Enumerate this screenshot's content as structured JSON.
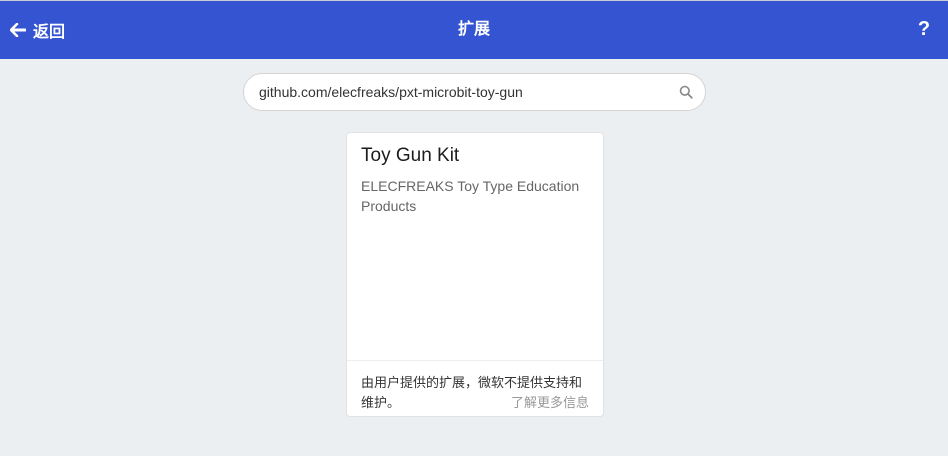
{
  "header": {
    "back_label": "返回",
    "title": "扩展",
    "help_label": "?",
    "color": "#3454d1"
  },
  "search": {
    "value": "github.com/elecfreaks/pxt-microbit-toy-gun",
    "icon": "search-icon"
  },
  "card": {
    "title": "Toy Gun Kit",
    "description": "ELECFREAKS Toy Type Education Products",
    "footer_text": "由用户提供的扩展，微软不提供支持和维护。",
    "learn_more": "了解更多信息"
  }
}
